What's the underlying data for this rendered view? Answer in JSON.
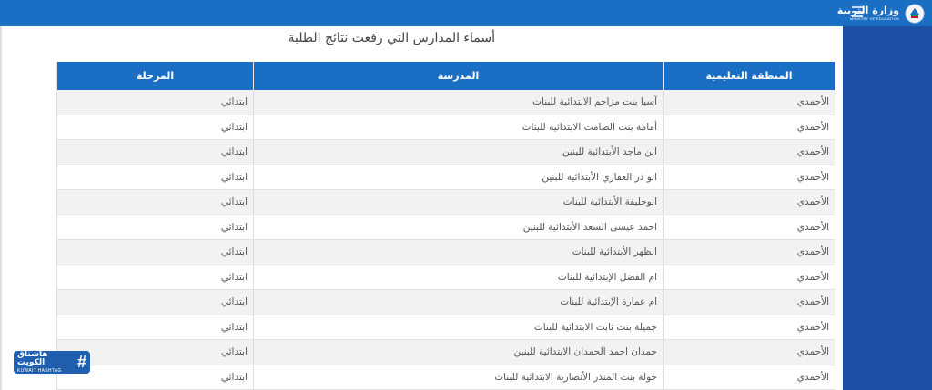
{
  "header": {
    "brand_ar": "وزارة التربية",
    "brand_en": "MINISTRY OF EDUCATION",
    "bar_color": "#1a6fc4",
    "side_panel_color": "#1c4fa3"
  },
  "page": {
    "title": "أسماء المدارس التي رفعت نتائج الطلبة"
  },
  "table": {
    "columns": [
      "المنطقة التعليمية",
      "المدرسة",
      "المرحلة"
    ],
    "rows": [
      [
        "الأحمدي",
        "آسيا بنت مزاحم الابتدائية للبنات",
        "ابتدائي"
      ],
      [
        "الأحمدي",
        "أمامة بنت الصامت الابتدائية للبنات",
        "ابتدائي"
      ],
      [
        "الأحمدي",
        "ابن ماجد الأبتدائية للبنين",
        "ابتدائي"
      ],
      [
        "الأحمدي",
        "ابو ذر الغفاري الأبتدائية للبنين",
        "ابتدائي"
      ],
      [
        "الأحمدي",
        "ابوحليفة الأبتدائية للبنات",
        "ابتدائي"
      ],
      [
        "الأحمدي",
        "احمد عيسى السعد الأبتدائية للبنين",
        "ابتدائي"
      ],
      [
        "الأحمدي",
        "الظهر الأبتدائية للبنات",
        "ابتدائي"
      ],
      [
        "الأحمدي",
        "ام الفضل الإبتدائية للبنات",
        "ابتدائي"
      ],
      [
        "الأحمدي",
        "ام عمارة الإبتدائية للبنات",
        "ابتدائي"
      ],
      [
        "الأحمدي",
        "جميلة بنت ثابت الابتدائية للبنات",
        "ابتدائي"
      ],
      [
        "الأحمدي",
        "حمدان احمد الحمدان الابتدائية للبنين",
        "ابتدائي"
      ],
      [
        "الأحمدي",
        "خولة بنت المنذر الأنصارية الابتدائية للبنات",
        "ابتدائي"
      ]
    ]
  },
  "watermark": {
    "ar": "هاشتاق الكويت",
    "en": "KUWAIT HASHTAG",
    "symbol": "#"
  }
}
